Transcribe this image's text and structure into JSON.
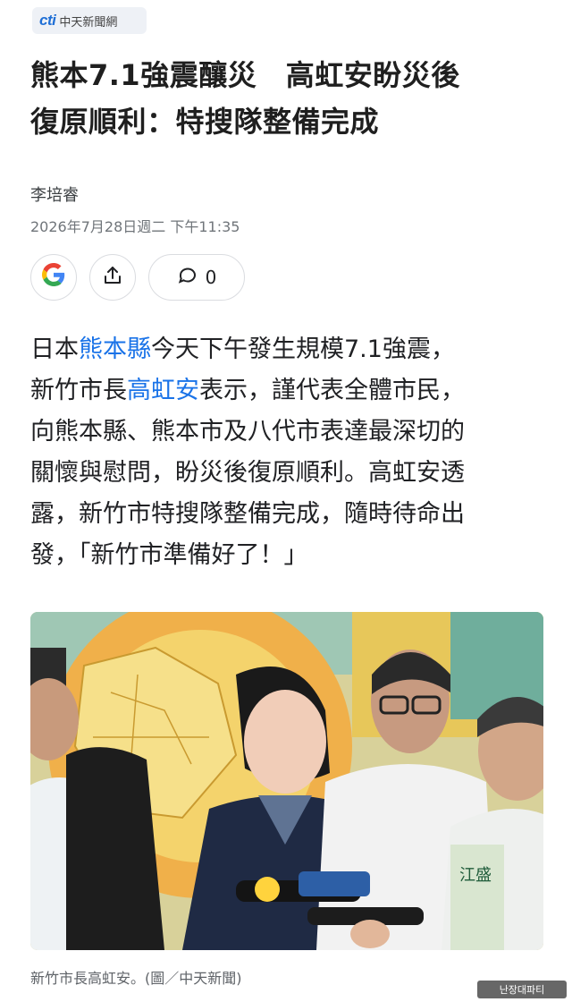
{
  "source": {
    "logo_mark": "cti",
    "name": "中天新聞網"
  },
  "article": {
    "title_line1": "熊本7.1強震釀災　高虹安盼災後",
    "title_line2": "復原順利：特搜隊整備完成",
    "author": "李培睿",
    "timestamp": "2026年7月28日週二 下午11:35"
  },
  "actions": {
    "google_icon": "G",
    "share_icon": "share-icon",
    "comment_icon": "comment-icon",
    "comment_count": "0"
  },
  "body": {
    "l1_a": "日本",
    "l1_link": "熊本縣",
    "l1_b": "今天下午發生規模7.1強震，",
    "l2_a": "新竹市長",
    "l2_link": "高虹安",
    "l2_b": "表示，謹代表全體市民，",
    "l3": "向熊本縣、熊本市及八代市表達最深切的",
    "l4": "關懷與慰問，盼災後復原順利。高虹安透",
    "l5": "露，新竹市特搜隊整備完成，隨時待命出",
    "l6": "發，「新竹市準備好了！」"
  },
  "photo": {
    "caption": "新竹市長高虹安。(圖／中天新聞)",
    "vest_text": "江盛"
  },
  "watermark": {
    "text": "난장대파티"
  },
  "colors": {
    "link": "#1a73e8",
    "brand": "#1f6fd6"
  }
}
